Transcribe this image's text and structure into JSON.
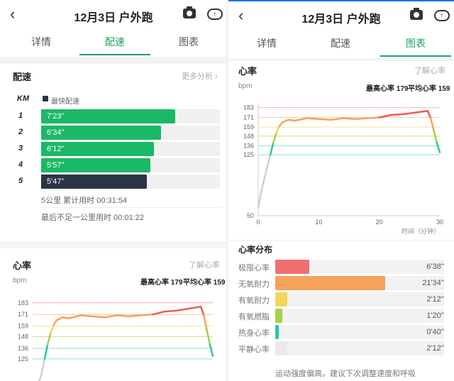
{
  "left": {
    "title": "12月3日 户外跑",
    "tabs": [
      "详情",
      "配速",
      "图表"
    ],
    "active_tab": 1,
    "pace": {
      "title": "配速",
      "more_link": "更多分析 ›",
      "km_header": "KM",
      "legend_label": "最快配速",
      "rows": [
        {
          "km": "1",
          "pace": "7'23''",
          "fraction": 0.75,
          "fastest": false
        },
        {
          "km": "2",
          "pace": "6'34''",
          "fraction": 0.67,
          "fastest": false
        },
        {
          "km": "3",
          "pace": "6'12''",
          "fraction": 0.63,
          "fastest": false
        },
        {
          "km": "4",
          "pace": "5'57''",
          "fraction": 0.61,
          "fastest": false
        },
        {
          "km": "5",
          "pace": "5'47''",
          "fraction": 0.59,
          "fastest": true
        }
      ],
      "summary": "5公里 累计用时 00:31:54",
      "remainder": "最后不足一公里用时 00:01:22"
    },
    "hr": {
      "title": "心率",
      "learn_link": "了解心率",
      "unit": "bpm",
      "max_label": "最高心率 179",
      "avg_label": "平均心率 159"
    }
  },
  "right": {
    "title": "12月3日 户外跑",
    "tabs": [
      "详情",
      "配速",
      "图表"
    ],
    "active_tab": 2,
    "hr": {
      "title": "心率",
      "learn_link": "了解心率",
      "unit": "bpm",
      "max_label": "最高心率 179",
      "avg_label": "平均心率 159",
      "x_unit": "时间（分钟）"
    },
    "distribution": {
      "title": "心率分布",
      "rows": [
        {
          "label": "极限心率",
          "value": "6'38''",
          "fraction": 0.2,
          "color": "#f07070"
        },
        {
          "label": "无氧耐力",
          "value": "21'34''",
          "fraction": 0.65,
          "color": "#f6a25a"
        },
        {
          "label": "有氧耐力",
          "value": "2'12''",
          "fraction": 0.07,
          "color": "#f5d55a"
        },
        {
          "label": "有氧燃脂",
          "value": "1'20''",
          "fraction": 0.04,
          "color": "#a5d14a"
        },
        {
          "label": "热身心率",
          "value": "0'40''",
          "fraction": 0.02,
          "color": "#2cc7a0"
        },
        {
          "label": "平静心率",
          "value": "2'12''",
          "fraction": 0.07,
          "color": "#e9e9e9"
        }
      ],
      "note": "运动强度偏高，建议下次调整速度和呼吸"
    }
  },
  "chart_data": [
    {
      "type": "line",
      "title": "心率",
      "ylabel": "bpm",
      "yticks": [
        183,
        171,
        159,
        148,
        136,
        125
      ],
      "zone_colors": [
        "#f07070",
        "#f6a25a",
        "#f5d55a",
        "#a5d14a",
        "#2cc7a0"
      ],
      "x": [
        0,
        0.5,
        1,
        1.5,
        2,
        2.5,
        3,
        3.5,
        4,
        5,
        6,
        8,
        10,
        12,
        14,
        16,
        18,
        20,
        22,
        24,
        26,
        27,
        28,
        28.5,
        29,
        29.5,
        30
      ],
      "y": [
        60,
        80,
        95,
        110,
        125,
        140,
        152,
        160,
        165,
        168,
        167,
        170,
        169,
        168,
        170,
        169,
        170,
        171,
        174,
        175,
        177,
        178,
        179,
        170,
        155,
        140,
        128
      ]
    },
    {
      "type": "line",
      "title": "心率",
      "xlabel": "时间（分钟）",
      "ylabel": "bpm",
      "yticks": [
        183,
        171,
        159,
        148,
        136,
        125,
        50
      ],
      "xticks": [
        0,
        10,
        20,
        30
      ],
      "xlim": [
        0,
        30
      ],
      "zone_colors": [
        "#f07070",
        "#f6a25a",
        "#f5d55a",
        "#a5d14a",
        "#2cc7a0"
      ],
      "x": [
        0,
        0.5,
        1,
        1.5,
        2,
        2.5,
        3,
        3.5,
        4,
        5,
        6,
        8,
        10,
        12,
        14,
        16,
        18,
        20,
        22,
        24,
        26,
        27,
        28,
        28.5,
        29,
        29.5,
        30
      ],
      "y": [
        60,
        80,
        95,
        110,
        125,
        140,
        152,
        160,
        165,
        168,
        167,
        170,
        169,
        168,
        170,
        169,
        170,
        171,
        174,
        175,
        177,
        178,
        179,
        170,
        155,
        140,
        128
      ]
    }
  ]
}
